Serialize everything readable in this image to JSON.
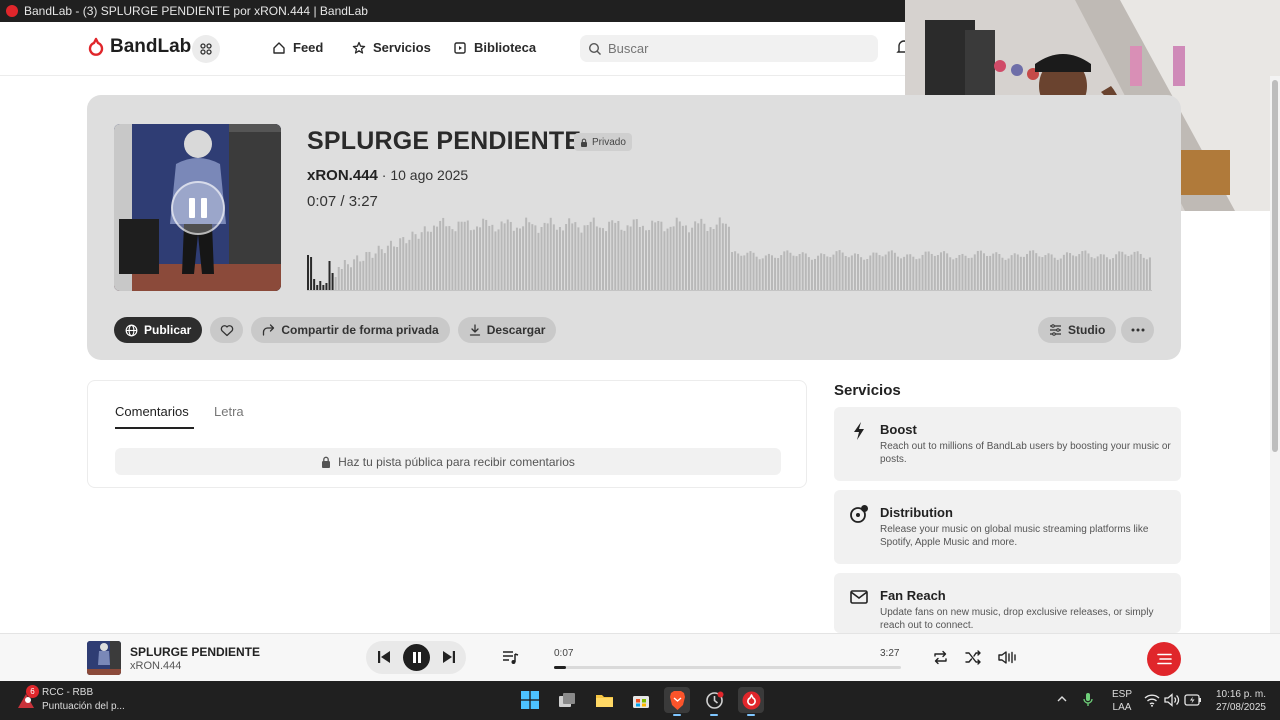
{
  "window": {
    "title": "BandLab - (3) SPLURGE PENDIENTE por xRON.444 | BandLab"
  },
  "nav": {
    "logo": "BandLab",
    "items": [
      {
        "label": "Feed",
        "icon": "home-icon"
      },
      {
        "label": "Servicios",
        "icon": "star-icon"
      },
      {
        "label": "Biblioteca",
        "icon": "library-icon"
      }
    ],
    "search_placeholder": "Buscar"
  },
  "track": {
    "title": "SPLURGE PENDIENTE",
    "badge": "Privado",
    "artist": "xRON.444",
    "date": "· 10 ago 2025",
    "current_time": "0:07 /",
    "total_time": "3:27",
    "progress": 0.034
  },
  "actions": {
    "publish": "Publicar",
    "share": "Compartir de forma privada",
    "download": "Descargar",
    "studio": "Studio"
  },
  "comments": {
    "tabs": [
      "Comentarios",
      "Letra"
    ],
    "active_tab": "Comentarios",
    "notice": "Haz tu pista pública para recibir comentarios"
  },
  "services": {
    "title": "Servicios",
    "cards": [
      {
        "name": "Boost",
        "desc": "Reach out to millions of BandLab users by boosting your music or posts.",
        "icon": "lightning-icon"
      },
      {
        "name": "Distribution",
        "desc": "Release your music on global music streaming platforms like Spotify, Apple Music and more.",
        "icon": "distribution-icon"
      },
      {
        "name": "Fan Reach",
        "desc": "Update fans on new music, drop exclusive releases, or simply reach out to connect.",
        "icon": "mail-icon"
      }
    ]
  },
  "player": {
    "title": "SPLURGE PENDIENTE",
    "artist": "xRON.444",
    "current": "0:07",
    "total": "3:27",
    "progress": 0.034
  },
  "taskbar": {
    "weather_badge": "6",
    "weather_title": "RCC - RBB",
    "weather_sub": "Puntuación del p...",
    "lang_top": "ESP",
    "lang_bottom": "LAA",
    "time": "10:16 p. m.",
    "date": "27/08/2025"
  },
  "colors": {
    "brand": "#e0262b",
    "hero_bg": "#dedede",
    "waveform": "#b8b8b8",
    "waveform_played": "#2a2a2a"
  }
}
